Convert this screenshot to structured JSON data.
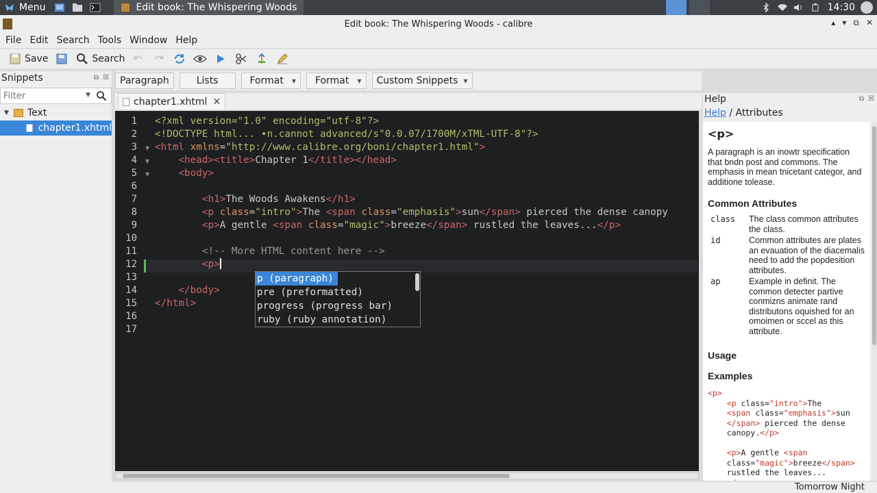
{
  "taskbar": {
    "menu_label": "Menu",
    "task_title": "Edit book: The Whispering Woods",
    "clock": "14:30"
  },
  "window": {
    "title": "Edit book: The Whispering Woods - calibre"
  },
  "menubar": [
    "File",
    "Edit",
    "Search",
    "Tools",
    "Window",
    "Help"
  ],
  "toolbar": {
    "save_label": "Save",
    "search_label": "Search"
  },
  "snippets_panel": {
    "title": "Snippets",
    "filter_placeholder": "Filter",
    "tree_folder": "Text",
    "tree_file": "chapter1.xhtml"
  },
  "snippet_bar": [
    "Paragraph",
    "Lists",
    "Format",
    "Format",
    "Custom Snippets"
  ],
  "editor": {
    "tab_label": "chapter1.xhtml",
    "line_numbers": [
      "1",
      "2",
      "3",
      "4",
      "5",
      "6",
      "7",
      "8",
      "9",
      "10",
      "11",
      "12",
      "13",
      "14",
      "15",
      "16",
      "17"
    ],
    "autocomplete": [
      "p (paragraph)",
      "pre (preformatted)",
      "progress (progress bar)",
      "ruby (ruby annotation)"
    ]
  },
  "help_panel": {
    "title": "Help",
    "breadcrumb_link": "Help",
    "breadcrumb_rest": " / Attributes",
    "tag": "<p>",
    "description": "A paragraph is an inowtr specification that bndn post and commons. The emphasis in mean tnicetant categor, and additione tolease.",
    "common_attributes_heading": "Common Attributes",
    "attributes": [
      {
        "name": "class",
        "desc": "The class common attributes the class."
      },
      {
        "name": "id",
        "desc": "Common attributes are plates an evauation of the diacemalis need to add the popdesition attributes."
      },
      {
        "name": "ap",
        "desc": "Example in definit. The common detecter partive conmizns animate rand distributons oquished for an omoimen or sccel as this attribute."
      }
    ],
    "usage_heading": "Usage",
    "examples_heading": "Examples"
  },
  "statusbar": {
    "theme": "Tomorrow Night"
  },
  "colors": {
    "editor_bg": "#1d1f21",
    "selection": "#3a86d8",
    "tag": "#cc6666",
    "attr": "#de935f",
    "string": "#b5bd68",
    "comment": "#969896"
  }
}
